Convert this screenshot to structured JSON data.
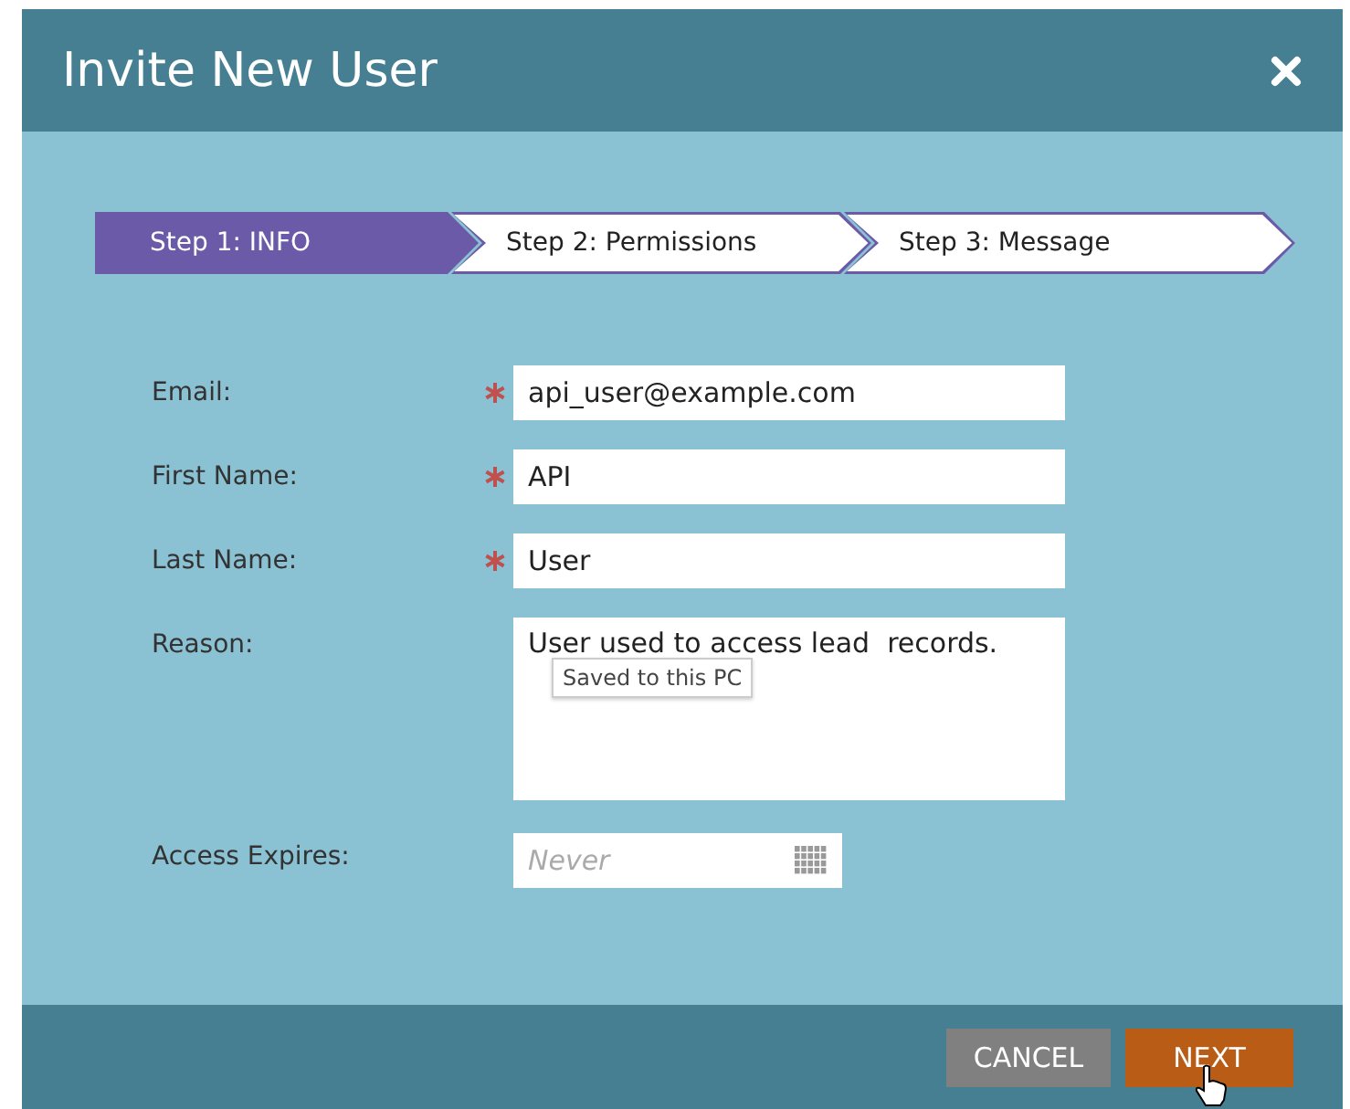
{
  "window": {
    "title": "Invite New User"
  },
  "steps": [
    {
      "label": "Step 1: INFO",
      "selected": true
    },
    {
      "label": "Step 2: Permissions",
      "selected": false
    },
    {
      "label": "Step 3: Message",
      "selected": false
    }
  ],
  "fields": [
    {
      "label": "Email:",
      "required": true,
      "kind": "text",
      "value": "api_user@example.com"
    },
    {
      "label": "First Name:",
      "required": true,
      "kind": "text",
      "value": "API"
    },
    {
      "label": "Last Name:",
      "required": true,
      "kind": "text",
      "value": "User"
    },
    {
      "label": "Reason:",
      "required": false,
      "kind": "textarea",
      "value": "User used to access lead  records.",
      "tooltip": "Saved to this PC"
    },
    {
      "label": "Access Expires:",
      "required": false,
      "kind": "date",
      "placeholder": "Never"
    }
  ],
  "buttons": [
    {
      "label": "CANCEL",
      "kind": "secondary"
    },
    {
      "label": "NEXT",
      "kind": "primary"
    }
  ]
}
